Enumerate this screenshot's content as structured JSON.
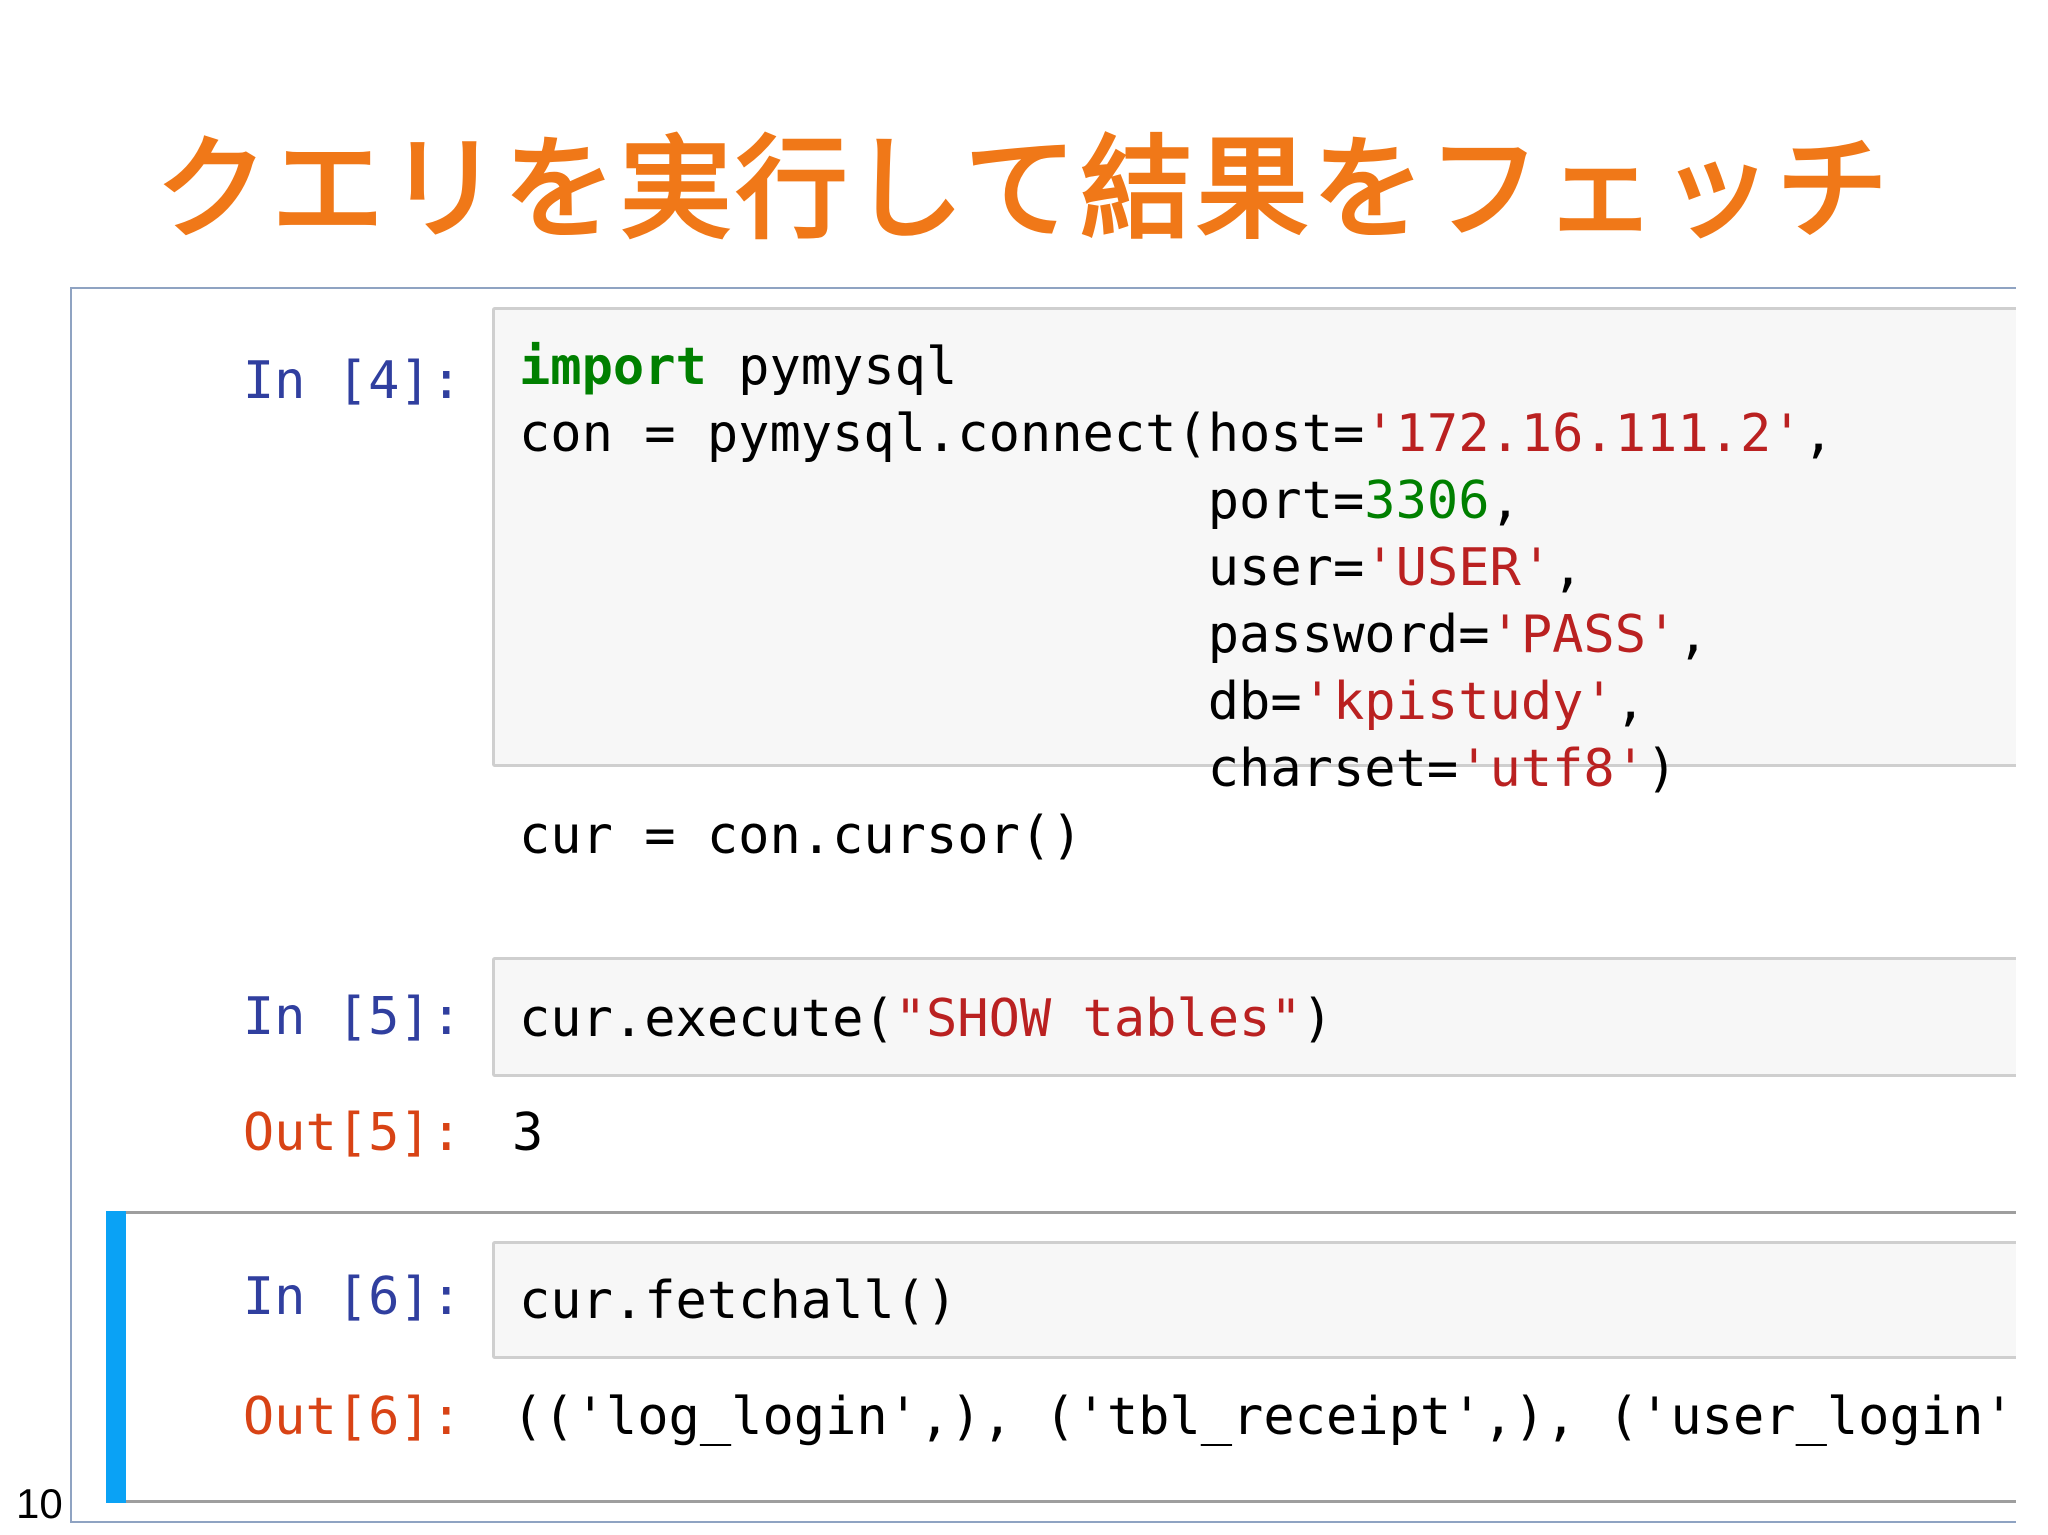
{
  "slide": {
    "title": "クエリを実行して結果をフェッチ",
    "page_number": "10"
  },
  "colors": {
    "title": "#f07818",
    "in_prompt": "#303f9f",
    "out_prompt": "#d84315",
    "keyword": "#008000",
    "string": "#ba2121",
    "number": "#008000",
    "selected_bar": "#0aa2f5"
  },
  "cells": {
    "cell4": {
      "prompt": "In [4]:",
      "lines": {
        "l1_kw": "import",
        "l1_rest": " pymysql",
        "l2_a": "con = pymysql.connect(host=",
        "l2_str": "'172.16.111.2'",
        "l2_b": ",",
        "l3_a": "                      port=",
        "l3_num": "3306",
        "l3_b": ",",
        "l4_a": "                      user=",
        "l4_str": "'USER'",
        "l4_b": ",",
        "l5_a": "                      password=",
        "l5_str": "'PASS'",
        "l5_b": ",",
        "l6_a": "                      db=",
        "l6_str": "'kpistudy'",
        "l6_b": ",",
        "l7_a": "                      charset=",
        "l7_str": "'utf8'",
        "l7_b": ")",
        "l8": "cur = con.cursor()"
      }
    },
    "cell5": {
      "prompt": "In [5]:",
      "code_a": "cur.execute(",
      "code_str": "\"SHOW tables\"",
      "code_b": ")",
      "out_prompt": "Out[5]:",
      "output": "3"
    },
    "cell6": {
      "prompt": "In [6]:",
      "code": "cur.fetchall()",
      "out_prompt": "Out[6]:",
      "output": "(('log_login',), ('tbl_receipt',), ('user_login',))"
    }
  }
}
